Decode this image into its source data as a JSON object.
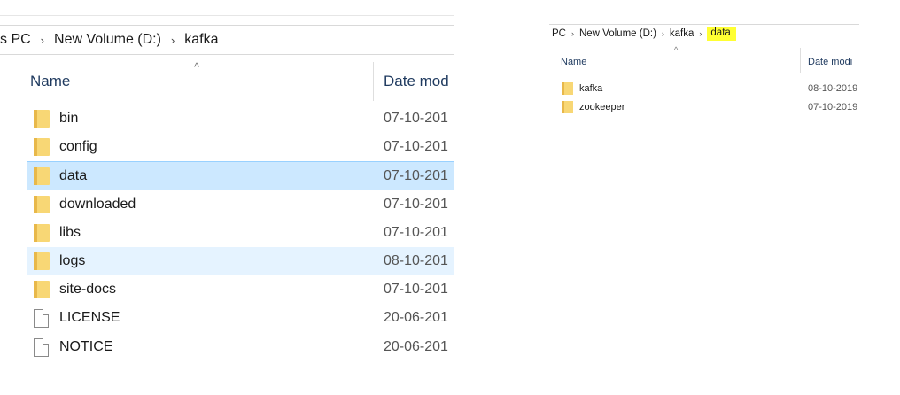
{
  "left_window": {
    "breadcrumb": [
      {
        "label": "s PC"
      },
      {
        "label": "New Volume (D:)"
      },
      {
        "label": "kafka"
      }
    ],
    "columns": {
      "name": "Name",
      "date": "Date mod"
    },
    "rows": [
      {
        "name": "bin",
        "date": "07-10-201",
        "type": "folder"
      },
      {
        "name": "config",
        "date": "07-10-201",
        "type": "folder"
      },
      {
        "name": "data",
        "date": "07-10-201",
        "type": "folder",
        "state": "selected"
      },
      {
        "name": "downloaded",
        "date": "07-10-201",
        "type": "folder"
      },
      {
        "name": "libs",
        "date": "07-10-201",
        "type": "folder"
      },
      {
        "name": "logs",
        "date": "08-10-201",
        "type": "folder",
        "state": "hover"
      },
      {
        "name": "site-docs",
        "date": "07-10-201",
        "type": "folder"
      },
      {
        "name": "LICENSE",
        "date": "20-06-201",
        "type": "file"
      },
      {
        "name": "NOTICE",
        "date": "20-06-201",
        "type": "file"
      }
    ]
  },
  "right_window": {
    "breadcrumb": [
      {
        "label": "PC"
      },
      {
        "label": "New Volume (D:)"
      },
      {
        "label": "kafka"
      },
      {
        "label": "data",
        "highlighted": true
      }
    ],
    "columns": {
      "name": "Name",
      "date": "Date modi"
    },
    "rows": [
      {
        "name": "kafka",
        "date": "08-10-2019",
        "type": "folder"
      },
      {
        "name": "zookeeper",
        "date": "07-10-2019",
        "type": "folder"
      }
    ]
  },
  "colors": {
    "selected_row": "#cce8ff",
    "hover_row": "#e5f3ff",
    "folder": "#f8d775",
    "highlight": "#ffff33"
  }
}
